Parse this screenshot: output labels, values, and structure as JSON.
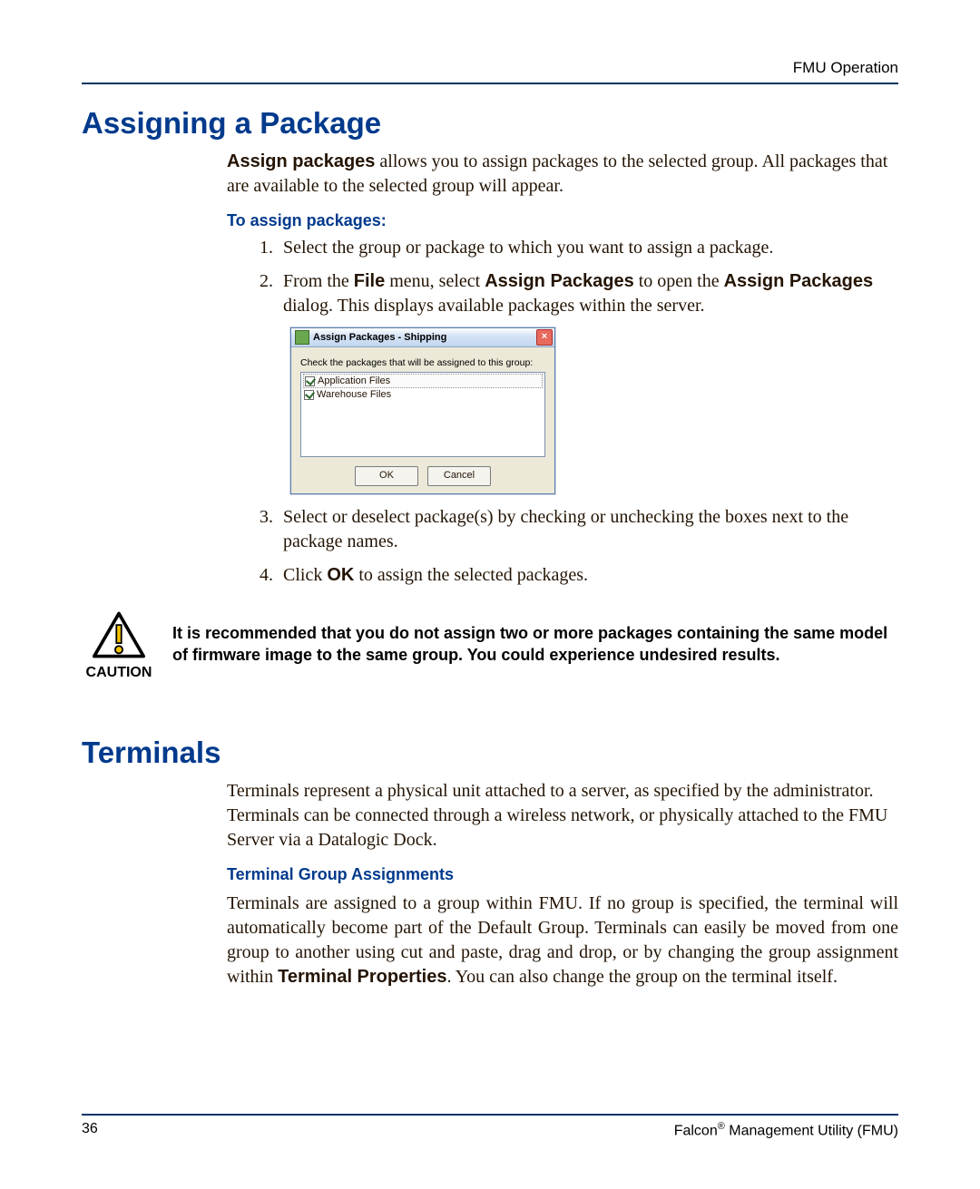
{
  "header": {
    "right": "FMU Operation"
  },
  "section1": {
    "title": "Assigning a Package",
    "intro_lead": "Assign packages",
    "intro_rest": " allows you to assign packages to the selected group. All packages that are available to the selected group will appear.",
    "subhead": "To assign packages:",
    "step1": "Select the group or package to which you want to assign a package.",
    "step2_a": "From the ",
    "step2_b": "File",
    "step2_c": " menu, select ",
    "step2_d": "Assign Packages",
    "step2_e": " to open the ",
    "step2_f": "Assign Packages",
    "step2_g": " dialog. This displays available packages within the server.",
    "step3": "Select or deselect package(s) by checking or unchecking the boxes next to the package names.",
    "step4_a": "Click ",
    "step4_b": "OK",
    "step4_c": " to assign the selected packages."
  },
  "dialog": {
    "title": "Assign Packages - Shipping",
    "close": "×",
    "instruction": "Check the packages that will be assigned to this group:",
    "item1": "Application Files",
    "item2": "Warehouse Files",
    "ok": "OK",
    "cancel": "Cancel"
  },
  "caution": {
    "label": "CAUTION",
    "text": "It is recommended that you do not assign two or more packages containing the same model of firmware image to the same group. You could experience undesired results."
  },
  "section2": {
    "title": "Terminals",
    "p1": "Terminals represent a physical unit attached to a server, as specified by the administrator. Terminals can be connected through a wireless network, or physically attached to the FMU Server via a Datalogic Dock.",
    "subhead": "Terminal Group Assignments",
    "p2_a": "Terminals are assigned to a group within FMU. If no group is specified, the terminal will automatically become part of the Default Group. Terminals can easily be moved from one group to another using cut and paste, drag and drop, or by changing the group assignment within ",
    "p2_b": "Terminal Properties",
    "p2_c": ". You can also change the group on the terminal itself."
  },
  "footer": {
    "page": "36",
    "product_a": "Falcon",
    "product_reg": "®",
    "product_b": " Management Utility (FMU)"
  }
}
